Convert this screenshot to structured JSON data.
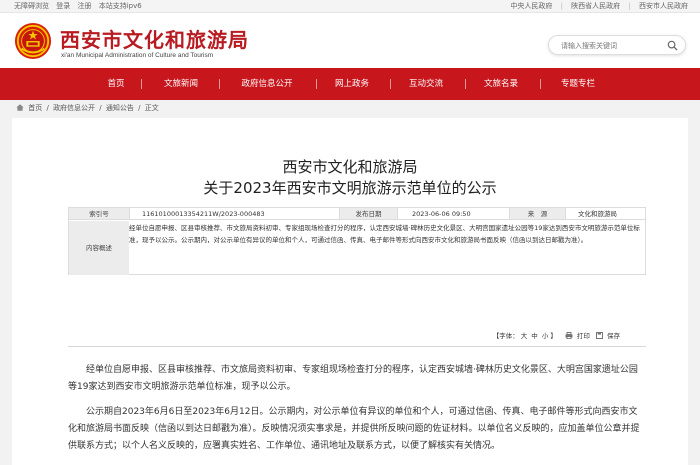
{
  "topbar": {
    "accessibility": "无障碍浏览",
    "login": "登录",
    "register": "注册",
    "ipv6": "本站支持ipv6",
    "links": [
      "中央人民政府",
      "陕西省人民政府",
      "西安市人民政府"
    ]
  },
  "header": {
    "title": "西安市文化和旅游局",
    "subtitle": "xi'an Municipal Administration of Culture and Tourism",
    "search_placeholder": "请输入搜索关键词",
    "brand_color": "#c8161d"
  },
  "nav": {
    "items": [
      "首页",
      "文旅新闻",
      "政府信息公开",
      "网上政务",
      "互动交流",
      "文旅名录",
      "专题专栏"
    ]
  },
  "breadcrumb": {
    "items": [
      "首页",
      "政府信息公开",
      "通知公告",
      "正文"
    ],
    "separator": "/"
  },
  "document": {
    "title_line1": "西安市文化和旅游局",
    "title_line2": "关于2023年西安市文明旅游示范单位的公示",
    "info": {
      "index_label": "索引号",
      "index_value": "11610100013354211W/2023-000483",
      "date_label": "发布日期",
      "date_value": "2023-06-06 09:50",
      "source_label": "来　源",
      "source_value": "文化和旅游局",
      "summary_label": "内容概述",
      "summary_value": "经单位自愿申报、区县审核推荐、市文旅局资料初审、专家组现场检查打分的程序，认定西安城墙·碑林历史文化景区、大明宫国家遗址公园等19家达到西安市文明旅游示范单位标准，现予以公示。公示期内，对公示单位有异议的单位和个人，可通过信函、传真、电子邮件等形式向西安市文化和旅游局书面反映（信函以到达日邮戳为准）。"
    },
    "toolbar": {
      "font_label": "【字体：",
      "large": "大",
      "medium": "中",
      "small": "小",
      "font_close": "】",
      "print": "打印",
      "save": "保存"
    },
    "paragraphs": [
      "经单位自愿申报、区县审核推荐、市文旅局资料初审、专家组现场检查打分的程序，认定西安城墙·碑林历史文化景区、大明宫国家遗址公园等19家达到西安市文明旅游示范单位标准，现予以公示。",
      "公示期自2023年6月6日至2023年6月12日。公示期内，对公示单位有异议的单位和个人，可通过信函、传真、电子邮件等形式向西安市文化和旅游局书面反映（信函以到达日邮戳为准）。反映情况须实事求是，并提供所反映问题的佐证材料。以单位名义反映的，应加盖单位公章并提供联系方式；以个人名义反映的，应署真实姓名、工作单位、通讯地址及联系方式，以便了解核实有关情况。"
    ]
  }
}
